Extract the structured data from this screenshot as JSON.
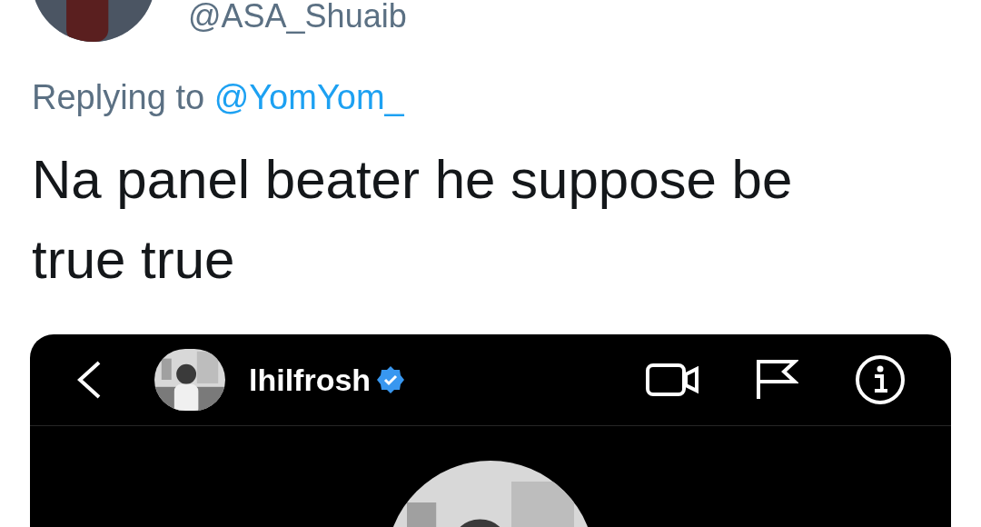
{
  "tweet": {
    "handle": "@ASA_Shuaib",
    "replying_prefix": "Replying to",
    "replying_to": "@YomYom_",
    "text": "Na panel beater he suppose be true true"
  },
  "embedded_screenshot": {
    "username": "lhilfrosh",
    "verified": true
  }
}
